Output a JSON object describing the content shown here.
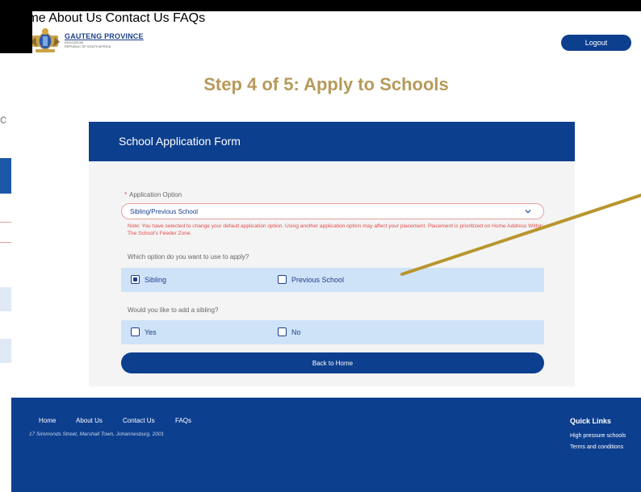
{
  "header": {
    "logo_title": "GAUTENG PROVINCE",
    "logo_sub1": "EDUCATION",
    "logo_sub2": "REPUBLIC OF SOUTH AFRICA",
    "nav": [
      "Home",
      "About Us",
      "Contact Us",
      "FAQs"
    ],
    "logout_label": "Logout"
  },
  "page_title": "Step 4 of 5: Apply to Schools",
  "form": {
    "title": "School Application Form",
    "required_mark": "*",
    "app_option_label": "Application Option",
    "app_option_value": "Sibling/Previous School",
    "note": "Note: You have selected to change your default application option. Using another application option may affect your placement. Placement is prioritized on Home Address Within The School's Feeder Zone.",
    "which_option_label": "Which option do you want to use to apply?",
    "sibling_label": "Sibling",
    "previous_school_label": "Previous School",
    "add_sibling_label": "Would you like to add a sibling?",
    "yes_label": "Yes",
    "no_label": "No",
    "back_button": "Back to Home",
    "sibling_checked": true,
    "previous_school_checked": false,
    "yes_checked": false,
    "no_checked": false
  },
  "footer": {
    "links": [
      "Home",
      "About Us",
      "Contact Us",
      "FAQs"
    ],
    "address": "17 Simmonds Street, Marshall Town, Johannesburg, 2001",
    "quick_links_title": "Quick Links",
    "quick_links": [
      "High pressure schools",
      "Terms and conditions"
    ]
  },
  "background_page": {
    "letter": "c"
  },
  "colors": {
    "brand_blue": "#0d3f8f",
    "gold": "#b69a5a",
    "error_red": "#e24a4a",
    "option_bg": "#cfe3f8",
    "annotation_arrow": "#b8962e"
  }
}
